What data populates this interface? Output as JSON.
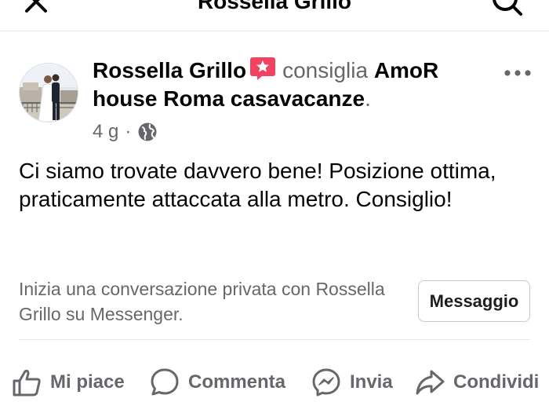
{
  "topbar": {
    "title": "Rossella Grillo"
  },
  "post": {
    "author": "Rossella Grillo",
    "verb": "consiglia",
    "page": "AmoR house Roma casavacanze",
    "period": ".",
    "time": "4 g",
    "separator": "·",
    "text": "Ci siamo trovate davvero bene! Posizione ottima, praticamente attaccata alla metro. Consiglio!"
  },
  "messenger": {
    "prompt": "Inizia una conversazione privata con Rossella Grillo su Messenger.",
    "button_label": "Messaggio"
  },
  "actions": {
    "like": "Mi piace",
    "comment": "Commenta",
    "send": "Invia",
    "share": "Condividi"
  },
  "colors": {
    "badge": "#f3425f",
    "secondary_text": "#65676b",
    "divider": "#e4e6eb"
  },
  "icons": [
    "close-icon",
    "search-icon",
    "recommendation-badge-icon",
    "more-icon",
    "globe-icon",
    "like-icon",
    "comment-icon",
    "messenger-icon",
    "share-icon"
  ]
}
